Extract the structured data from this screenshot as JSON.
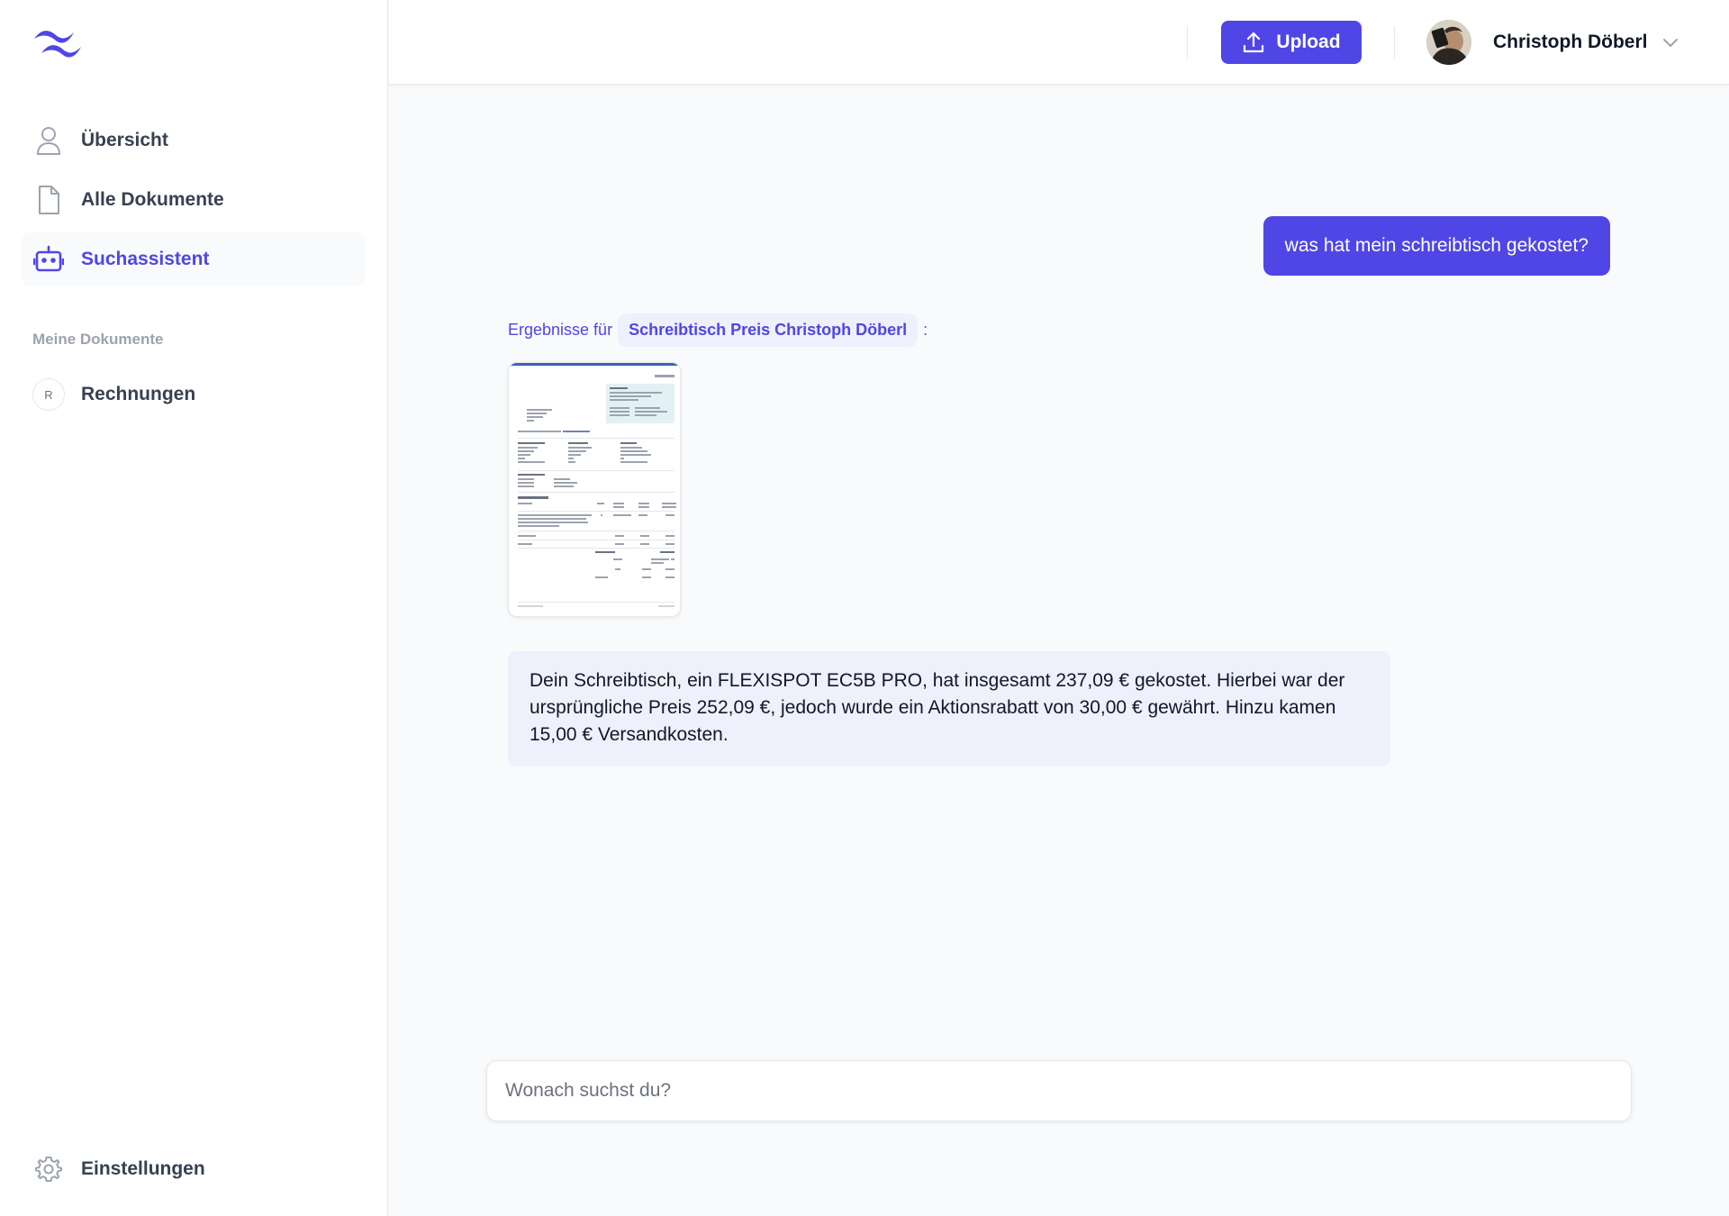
{
  "sidebar": {
    "nav": [
      {
        "label": "Übersicht",
        "icon": "user-icon"
      },
      {
        "label": "Alle Dokumente",
        "icon": "document-icon"
      },
      {
        "label": "Suchassistent",
        "icon": "robot-icon",
        "active": true
      }
    ],
    "section_label": "Meine Dokumente",
    "folders": [
      {
        "badge": "R",
        "label": "Rechnungen"
      }
    ],
    "settings_label": "Einstellungen"
  },
  "header": {
    "upload_label": "Upload",
    "user_name": "Christoph Döberl"
  },
  "chat": {
    "user_message": "was hat mein schreibtisch gekostet?",
    "results_prefix": "Ergebnisse für",
    "query": "Schreibtisch Preis Christoph Döberl",
    "results_suffix": ":",
    "answer": "Dein Schreibtisch, ein FLEXISPOT EC5B PRO, hat insgesamt 237,09 € gekostet. Hierbei war der ursprüngliche Preis 252,09 €, jedoch wurde ein Aktionsrabatt von 30,00 € gewährt. Hinzu kamen 15,00 € Versandkosten."
  },
  "search": {
    "placeholder": "Wonach suchst du?",
    "value": ""
  },
  "colors": {
    "accent": "#4f46e5",
    "accent_soft": "#eef0fb",
    "text": "#111827",
    "muted": "#9ca3af"
  }
}
